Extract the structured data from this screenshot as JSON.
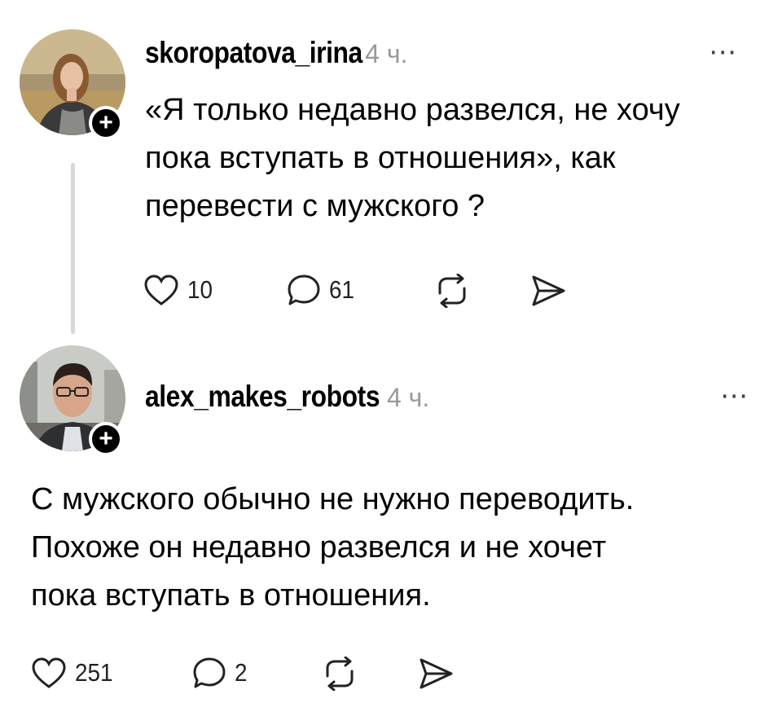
{
  "posts": [
    {
      "username": "skoropatova_irina",
      "time": "4 ч.",
      "more_icon": "⋯",
      "text_lines": [
        "«Я только недавно развелся, не хочу",
        "пока вступать в отношения», как",
        "перевести с мужского ?"
      ],
      "likes": "10",
      "replies": "61"
    },
    {
      "username": "alex_makes_robots",
      "time": "4 ч.",
      "more_icon": "⋯",
      "text_lines": [
        "С мужского обычно не нужно переводить.",
        "Похоже он недавно развелся и не хочет",
        "пока вступать в отношения."
      ],
      "likes": "251",
      "replies": "2"
    }
  ],
  "follow_badge": "+",
  "icons": [
    "heart-icon",
    "comment-icon",
    "repost-icon",
    "share-icon",
    "more-icon",
    "follow-icon"
  ]
}
